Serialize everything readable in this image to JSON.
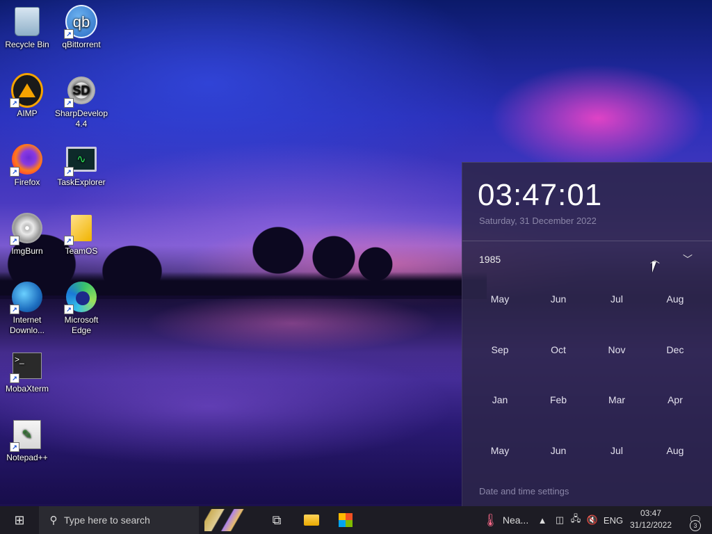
{
  "desktop": {
    "icons": [
      {
        "label": "Recycle Bin"
      },
      {
        "label": "qBittorrent"
      },
      {
        "label": "AIMP"
      },
      {
        "label": "SharpDevelop 4.4"
      },
      {
        "label": "Firefox"
      },
      {
        "label": "TaskExplorer"
      },
      {
        "label": "ImgBurn"
      },
      {
        "label": "TeamOS"
      },
      {
        "label": "Internet Downlo..."
      },
      {
        "label": "Microsoft Edge"
      },
      {
        "label": "MobaXterm"
      },
      {
        "label": "Notepad++"
      }
    ],
    "glyph_text": {
      "qbittorrent": "qb",
      "sharpdevelop": "SD",
      "terminal": ">_"
    }
  },
  "calendar": {
    "time": "03:47:01",
    "date": "Saturday, 31 December 2022",
    "year": "1985",
    "months": [
      "May",
      "Jun",
      "Jul",
      "Aug",
      "Sep",
      "Oct",
      "Nov",
      "Dec",
      "Jan",
      "Feb",
      "Mar",
      "Apr",
      "May",
      "Jun",
      "Jul",
      "Aug"
    ],
    "settings_link": "Date and time settings",
    "nav_up_icon": "chevron-up-icon",
    "nav_down_icon": "chevron-down-icon"
  },
  "taskbar": {
    "search_placeholder": "Type here to search",
    "weather_text": "Nea...",
    "language": "ENG",
    "clock_time": "03:47",
    "clock_date": "31/12/2022",
    "notification_count": "3"
  },
  "colors": {
    "flyout_bg": "#2c264a",
    "taskbar_bg": "#1d1c24",
    "muted_text": "#8b86a8"
  }
}
